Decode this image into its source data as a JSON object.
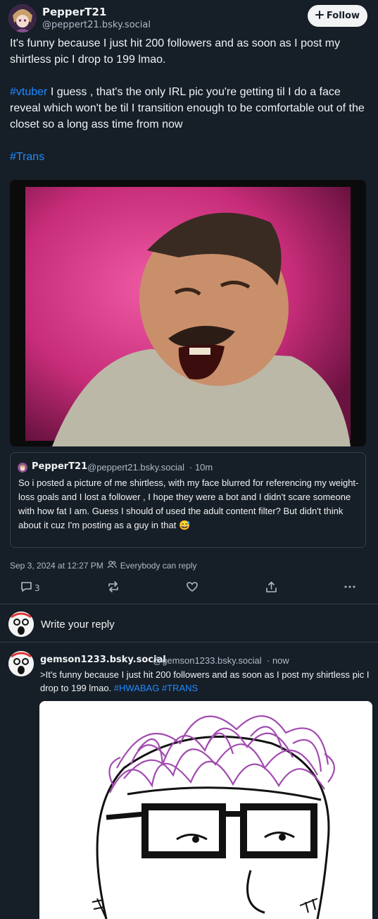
{
  "post": {
    "author_name": "PepperT21",
    "author_handle": "@peppert21.bsky.social",
    "follow_label": "Follow",
    "text_line1": "It's funny because I just hit 200 followers and as soon as I post my shirtless pic I drop to 199 lmao.",
    "tag_vtuber": "#vtuber",
    "text_line2": " I guess , that's the only IRL pic you're getting til I do a face reveal which won't be til I transition enough to be comfortable out of the closet so a long ass time from now",
    "tag_trans": "#Trans",
    "timestamp": "Sep 3, 2024 at 12:27 PM",
    "visibility": "Everybody can reply",
    "reply_count": "3"
  },
  "quote": {
    "author_name": "PepperT21",
    "author_handle": "@peppert21.bsky.social",
    "time": "· 10m",
    "text": "So i posted a picture of me shirtless,  with my face blurred for referencing my weight-loss goals and I lost a follower , I hope they were a bot and I didn't scare someone with how fat I am. Guess I should of used the adult content filter? But didn't think about it cuz I'm posting as a guy in that 😅"
  },
  "composer": {
    "placeholder": "Write your reply"
  },
  "reply": {
    "author_name": "gemson1233.bsky.social",
    "author_handle": "@gemson1233.bsky.social",
    "time": "· now",
    "text": ">It's funny because I just hit 200 followers and as soon as I post my shirtless pic I drop to 199 lmao. ",
    "tag_hwabag": " #HWABAG",
    "tag_trans": " #TRANS"
  },
  "colors": {
    "background": "#161e27",
    "link": "#208bfe",
    "border": "#2e4052",
    "muted": "#aebbc9"
  },
  "icons": [
    "plus-icon",
    "reply-icon",
    "repost-icon",
    "like-icon",
    "share-icon",
    "more-icon",
    "people-icon",
    "laughing-emoji"
  ]
}
